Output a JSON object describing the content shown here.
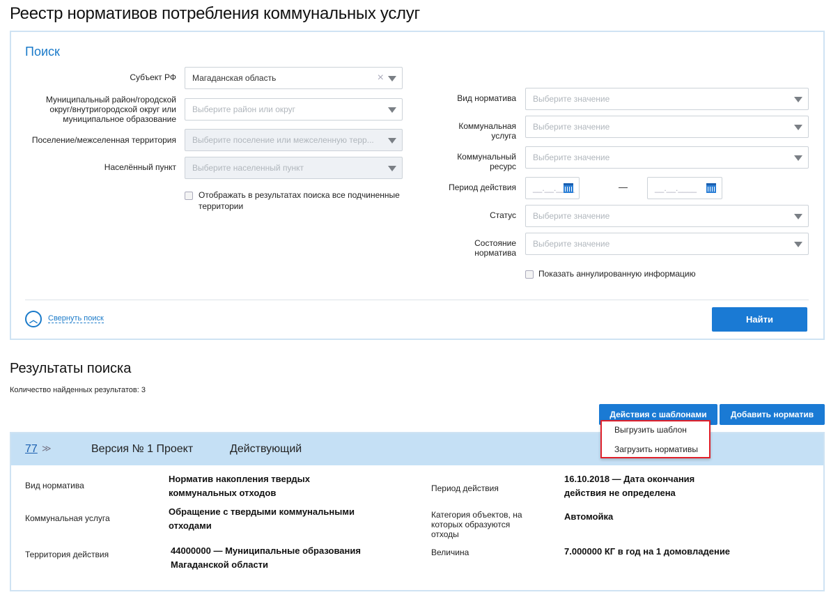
{
  "title": "Реестр нормативов потребления коммунальных услуг",
  "search": {
    "title": "Поиск",
    "subject": {
      "label": "Субъект РФ",
      "value": "Магаданская область"
    },
    "district": {
      "label": "Муниципальный район/городской округ/внутригородской округ или муниципальное образование",
      "placeholder": "Выберите район или округ"
    },
    "settlement": {
      "label": "Поселение/межселенная территория",
      "placeholder": "Выберите поселение или межселенную терр..."
    },
    "locality": {
      "label": "Населённый пункт",
      "placeholder": "Выберите населенный пункт"
    },
    "show_subordinate": "Отображать в результатах поиска все подчиненные территории",
    "norm_type": {
      "label": "Вид норматива",
      "placeholder": "Выберите значение"
    },
    "service": {
      "label": "Коммунальная услуга",
      "placeholder": "Выберите значение"
    },
    "resource": {
      "label": "Коммунальный ресурс",
      "placeholder": "Выберите значение"
    },
    "period": {
      "label": "Период действия",
      "from": "__.__.____",
      "to": "__.__.____",
      "dash": "—"
    },
    "status": {
      "label": "Статус",
      "placeholder": "Выберите значение"
    },
    "state": {
      "label": "Состояние норматива",
      "placeholder": "Выберите значение"
    },
    "show_annulled": "Показать аннулированную информацию",
    "collapse": "Свернуть поиск",
    "find": "Найти"
  },
  "results": {
    "title": "Результаты поиска",
    "count": "Количество найденных результатов: 3",
    "templates_button": "Действия с шаблонами",
    "add_button": "Добавить норматив",
    "menu": [
      "Выгрузить шаблон",
      "Загрузить нормативы"
    ],
    "item": {
      "id": "77",
      "version": "Версия № 1 Проект",
      "status": "Действующий",
      "fields": {
        "norm_type": {
          "label": "Вид норматива",
          "value": "Норматив накопления твердых коммунальных отходов"
        },
        "service": {
          "label": "Коммунальная услуга",
          "value": "Обращение с твердыми коммунальными отходами"
        },
        "territory": {
          "label": "Территория действия",
          "value": "44000000 — Муниципальные образования Магаданской области"
        },
        "period": {
          "label": "Период действия",
          "value": "16.10.2018 — Дата окончания действия не определена"
        },
        "category": {
          "label": "Категория объектов, на которых образуются отходы",
          "value": "Автомойка"
        },
        "amount": {
          "label": "Величина",
          "value": "7.000000 КГ в год на 1 домовладение"
        }
      }
    }
  }
}
